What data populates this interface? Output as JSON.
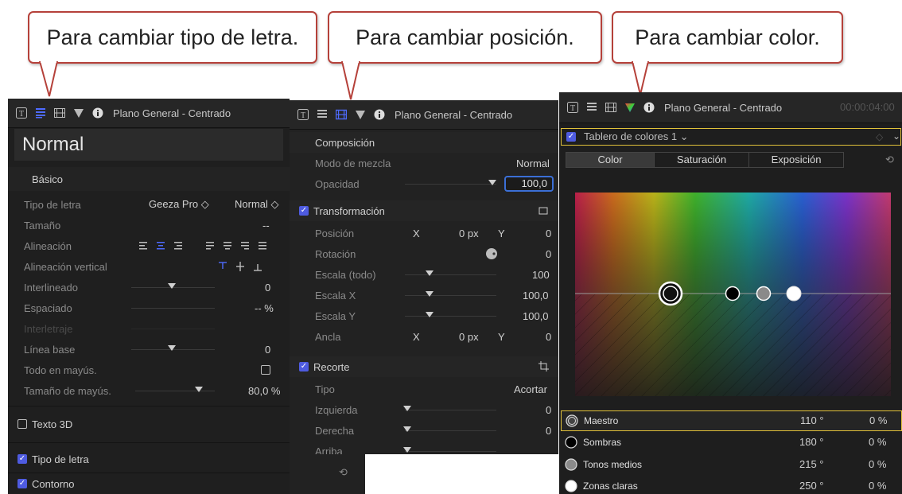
{
  "callouts": {
    "font": "Para cambiar tipo de letra.",
    "position": "Para cambiar posición.",
    "color": "Para cambiar color."
  },
  "panel1": {
    "title": "Plano General - Centrado",
    "style_name": "Normal",
    "basic_header": "Básico",
    "rows": {
      "font_label": "Tipo de letra",
      "font_value": "Geeza Pro ◇",
      "font_weight": "Normal ◇",
      "size_label": "Tamaño",
      "size_value": "--",
      "align_label": "Alineación",
      "valign_label": "Alineación vertical",
      "leading_label": "Interlineado",
      "leading_value": "0",
      "tracking_label": "Espaciado",
      "tracking_value": "-- %",
      "kerning_label": "Interletraje",
      "baseline_label": "Línea base",
      "baseline_value": "0",
      "allcaps_label": "Todo en mayús.",
      "capsize_label": "Tamaño de mayús.",
      "capsize_value": "80,0 %"
    },
    "text3d": "Texto 3D",
    "face": "Tipo de letra",
    "outline": "Contorno"
  },
  "panel2": {
    "title": "Plano General - Centrado",
    "composition": "Composición",
    "blend_label": "Modo de mezcla",
    "blend_value": "Normal",
    "opacity_label": "Opacidad",
    "opacity_value": "100,0",
    "transform": "Transformación",
    "position_label": "Posición",
    "x": "X",
    "y": "Y",
    "px0": "0 px",
    "zero": "0",
    "rotation_label": "Rotación",
    "scale_all_label": "Escala (todo)",
    "scale_all_value": "100",
    "scale_x_label": "Escala X",
    "scale_x_value": "100,0",
    "scale_y_label": "Escala Y",
    "scale_y_value": "100,0",
    "anchor_label": "Ancla",
    "crop": "Recorte",
    "type_label": "Tipo",
    "type_value": "Acortar",
    "left_label": "Izquierda",
    "right_label": "Derecha",
    "top_label": "Arriba",
    "reset_icon": "⟲"
  },
  "panel3": {
    "title": "Plano General - Centrado",
    "timecode": "00:00:04:00",
    "board": "Tablero de colores 1 ⌄",
    "tabs": [
      "Color",
      "Saturación",
      "Exposición"
    ],
    "rows": [
      {
        "name": "Maestro",
        "angle": "110 °",
        "pct": "0 %"
      },
      {
        "name": "Sombras",
        "angle": "180 °",
        "pct": "0 %"
      },
      {
        "name": "Tonos medios",
        "angle": "215 °",
        "pct": "0 %"
      },
      {
        "name": "Zonas claras",
        "angle": "250 °",
        "pct": "0 %"
      }
    ]
  },
  "colors": {
    "accent": "#4e5be0",
    "callout_border": "#b5413a",
    "highlight": "#e1c13a"
  }
}
